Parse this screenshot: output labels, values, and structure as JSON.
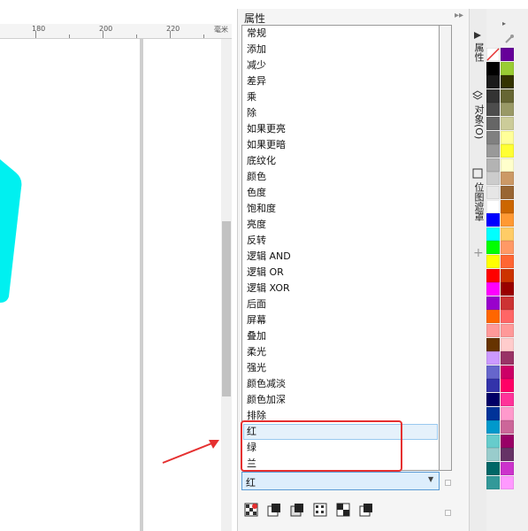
{
  "ruler": {
    "ticks": [
      "180",
      "200",
      "220",
      "毫米"
    ]
  },
  "panel": {
    "title": "属性",
    "collapse_icon": "double-arrow-right-icon",
    "close_label": "×"
  },
  "blend_modes": {
    "items": [
      "常规",
      "添加",
      "减少",
      "差异",
      "乘",
      "除",
      "如果更亮",
      "如果更暗",
      "底纹化",
      "颜色",
      "色度",
      "饱和度",
      "亮度",
      "反转",
      "逻辑 AND",
      "逻辑 OR",
      "逻辑 XOR",
      "后面",
      "屏幕",
      "叠加",
      "柔光",
      "强光",
      "颜色减淡",
      "颜色加深",
      "排除",
      "红",
      "绿",
      "兰"
    ],
    "highlighted": "红"
  },
  "channel_select": {
    "value": "红"
  },
  "side_tabs": {
    "properties": "属性",
    "objects": "对象(O)",
    "bitmap_mask": "位图遮罩"
  },
  "palette_colors": {
    "col1": [
      "#ffffff",
      "#000000",
      "#1a1a1a",
      "#333333",
      "#4d4d4d",
      "#666666",
      "#808080",
      "#999999",
      "#b3b3b3",
      "#cccccc",
      "#e6e6e6",
      "#ffffff",
      "#0000ff",
      "#00ffff",
      "#00ff00",
      "#ffff00",
      "#ff0000",
      "#ff00ff",
      "#9900cc",
      "#ff6600",
      "#ff9999",
      "#663300",
      "#cc99ff",
      "#6666cc",
      "#3333aa",
      "#000066",
      "#003399",
      "#0099cc",
      "#66cccc",
      "#99cccc",
      "#006666",
      "#339999"
    ],
    "col2": [
      "#660099",
      "#99cc33",
      "#333300",
      "#666633",
      "#999966",
      "#cccc99",
      "#ffff99",
      "#ffff33",
      "#ffffcc",
      "#cc9966",
      "#996633",
      "#cc6600",
      "#ff9933",
      "#ffcc66",
      "#ff9966",
      "#ff6633",
      "#cc3300",
      "#990000",
      "#cc3333",
      "#ff6666",
      "#ff9999",
      "#ffcccc",
      "#993366",
      "#cc0066",
      "#ff0066",
      "#ff3399",
      "#ff99cc",
      "#cc6699",
      "#990066",
      "#663366",
      "#cc33cc",
      "#ff99ff"
    ]
  }
}
